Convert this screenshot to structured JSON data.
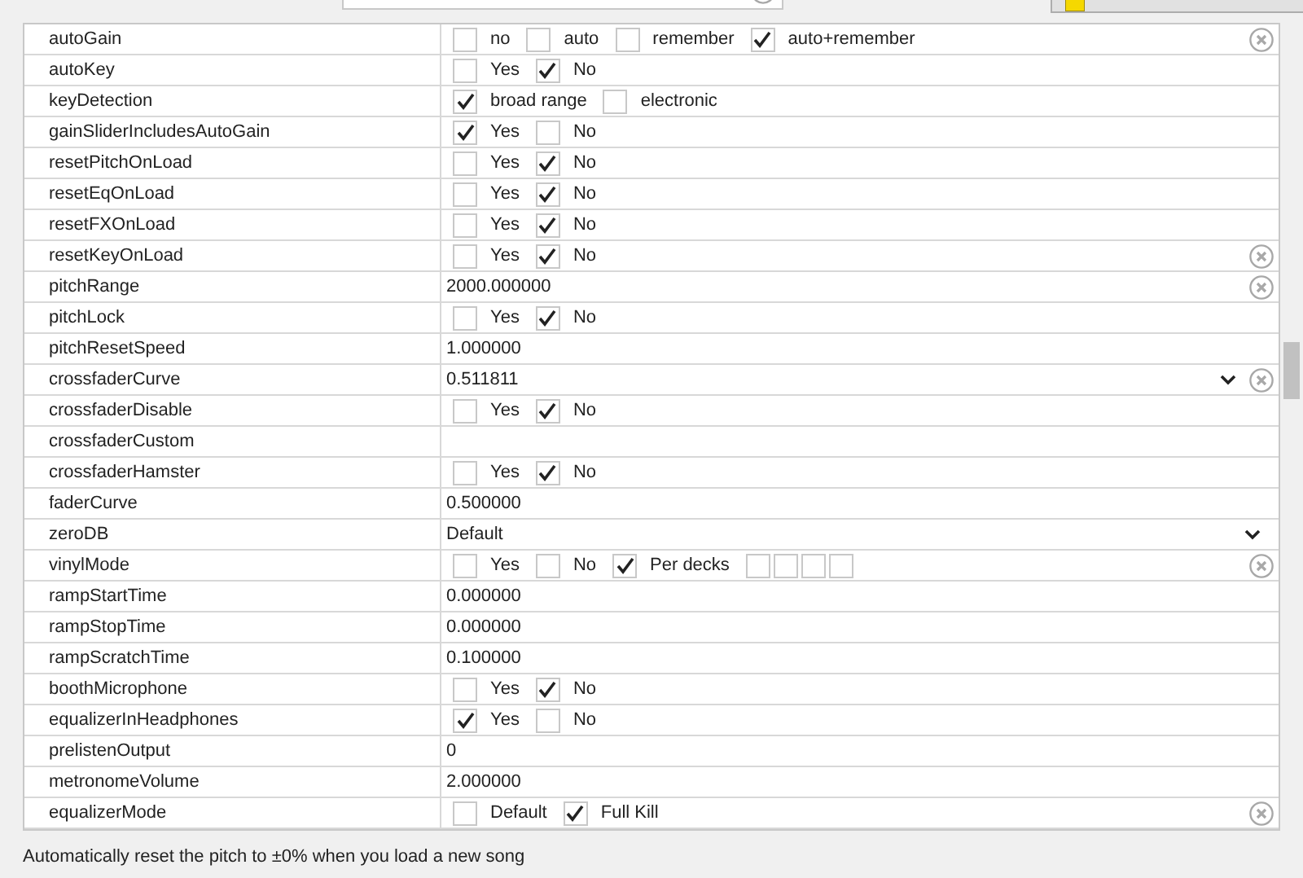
{
  "rows": [
    {
      "name": "autoGain",
      "kind": "options",
      "resettable": true,
      "options": [
        {
          "label": "no",
          "checked": false
        },
        {
          "label": "auto",
          "checked": false
        },
        {
          "label": "remember",
          "checked": false
        },
        {
          "label": "auto+remember",
          "checked": true
        }
      ]
    },
    {
      "name": "autoKey",
      "kind": "options",
      "resettable": false,
      "options": [
        {
          "label": "Yes",
          "checked": false
        },
        {
          "label": "No",
          "checked": true
        }
      ]
    },
    {
      "name": "keyDetection",
      "kind": "options",
      "resettable": false,
      "options": [
        {
          "label": "broad range",
          "checked": true
        },
        {
          "label": "electronic",
          "checked": false
        }
      ]
    },
    {
      "name": "gainSliderIncludesAutoGain",
      "kind": "options",
      "resettable": false,
      "options": [
        {
          "label": "Yes",
          "checked": true
        },
        {
          "label": "No",
          "checked": false
        }
      ]
    },
    {
      "name": "resetPitchOnLoad",
      "kind": "options",
      "resettable": false,
      "options": [
        {
          "label": "Yes",
          "checked": false
        },
        {
          "label": "No",
          "checked": true
        }
      ]
    },
    {
      "name": "resetEqOnLoad",
      "kind": "options",
      "resettable": false,
      "options": [
        {
          "label": "Yes",
          "checked": false
        },
        {
          "label": "No",
          "checked": true
        }
      ]
    },
    {
      "name": "resetFXOnLoad",
      "kind": "options",
      "resettable": false,
      "options": [
        {
          "label": "Yes",
          "checked": false
        },
        {
          "label": "No",
          "checked": true
        }
      ]
    },
    {
      "name": "resetKeyOnLoad",
      "kind": "options",
      "resettable": true,
      "options": [
        {
          "label": "Yes",
          "checked": false
        },
        {
          "label": "No",
          "checked": true
        }
      ]
    },
    {
      "name": "pitchRange",
      "kind": "text",
      "resettable": true,
      "value": "2000.000000"
    },
    {
      "name": "pitchLock",
      "kind": "options",
      "resettable": false,
      "options": [
        {
          "label": "Yes",
          "checked": false
        },
        {
          "label": "No",
          "checked": true
        }
      ]
    },
    {
      "name": "pitchResetSpeed",
      "kind": "text",
      "resettable": false,
      "value": "1.000000"
    },
    {
      "name": "crossfaderCurve",
      "kind": "dropdown",
      "resettable": true,
      "value": "0.511811"
    },
    {
      "name": "crossfaderDisable",
      "kind": "options",
      "resettable": false,
      "options": [
        {
          "label": "Yes",
          "checked": false
        },
        {
          "label": "No",
          "checked": true
        }
      ]
    },
    {
      "name": "crossfaderCustom",
      "kind": "empty",
      "resettable": false
    },
    {
      "name": "crossfaderHamster",
      "kind": "options",
      "resettable": false,
      "options": [
        {
          "label": "Yes",
          "checked": false
        },
        {
          "label": "No",
          "checked": true
        }
      ]
    },
    {
      "name": "faderCurve",
      "kind": "text",
      "resettable": false,
      "value": "0.500000"
    },
    {
      "name": "zeroDB",
      "kind": "dropdown",
      "resettable": false,
      "value": "Default"
    },
    {
      "name": "vinylMode",
      "kind": "options",
      "resettable": true,
      "options": [
        {
          "label": "Yes",
          "checked": false
        },
        {
          "label": "No",
          "checked": false
        },
        {
          "label": "Per decks",
          "checked": true
        },
        {
          "checked": false
        },
        {
          "checked": false
        },
        {
          "checked": false
        },
        {
          "checked": false
        }
      ]
    },
    {
      "name": "rampStartTime",
      "kind": "text",
      "resettable": false,
      "value": "0.000000"
    },
    {
      "name": "rampStopTime",
      "kind": "text",
      "resettable": false,
      "value": "0.000000"
    },
    {
      "name": "rampScratchTime",
      "kind": "text",
      "resettable": false,
      "value": "0.100000"
    },
    {
      "name": "boothMicrophone",
      "kind": "options",
      "resettable": false,
      "options": [
        {
          "label": "Yes",
          "checked": false
        },
        {
          "label": "No",
          "checked": true
        }
      ]
    },
    {
      "name": "equalizerInHeadphones",
      "kind": "options",
      "resettable": false,
      "options": [
        {
          "label": "Yes",
          "checked": true
        },
        {
          "label": "No",
          "checked": false
        }
      ]
    },
    {
      "name": "prelistenOutput",
      "kind": "text",
      "resettable": false,
      "value": "0"
    },
    {
      "name": "metronomeVolume",
      "kind": "text",
      "resettable": false,
      "value": "2.000000"
    },
    {
      "name": "equalizerMode",
      "kind": "options",
      "resettable": true,
      "options": [
        {
          "label": "Default",
          "checked": false
        },
        {
          "label": "Full Kill",
          "checked": true
        }
      ]
    }
  ],
  "description": "Automatically reset the pitch to ±0% when you load a new song"
}
